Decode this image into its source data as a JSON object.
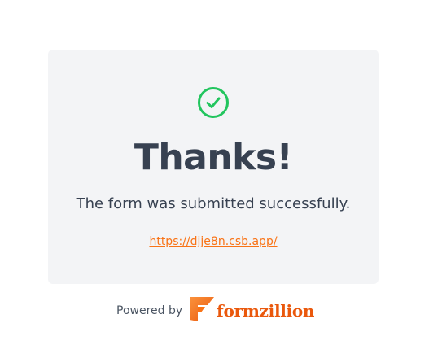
{
  "confirmation": {
    "icon": "check-circle-icon",
    "title": "Thanks!",
    "message": "The form was submitted successfully.",
    "link_text": "https://djje8n.csb.app/"
  },
  "footer": {
    "powered_by": "Powered by",
    "brand_name": "formzillion",
    "brand_icon": "formzillion-logo-icon"
  },
  "colors": {
    "success": "#22c55e",
    "heading": "#374151",
    "link": "#f97316",
    "brand": "#ea580c",
    "card_background": "#f3f4f6"
  }
}
